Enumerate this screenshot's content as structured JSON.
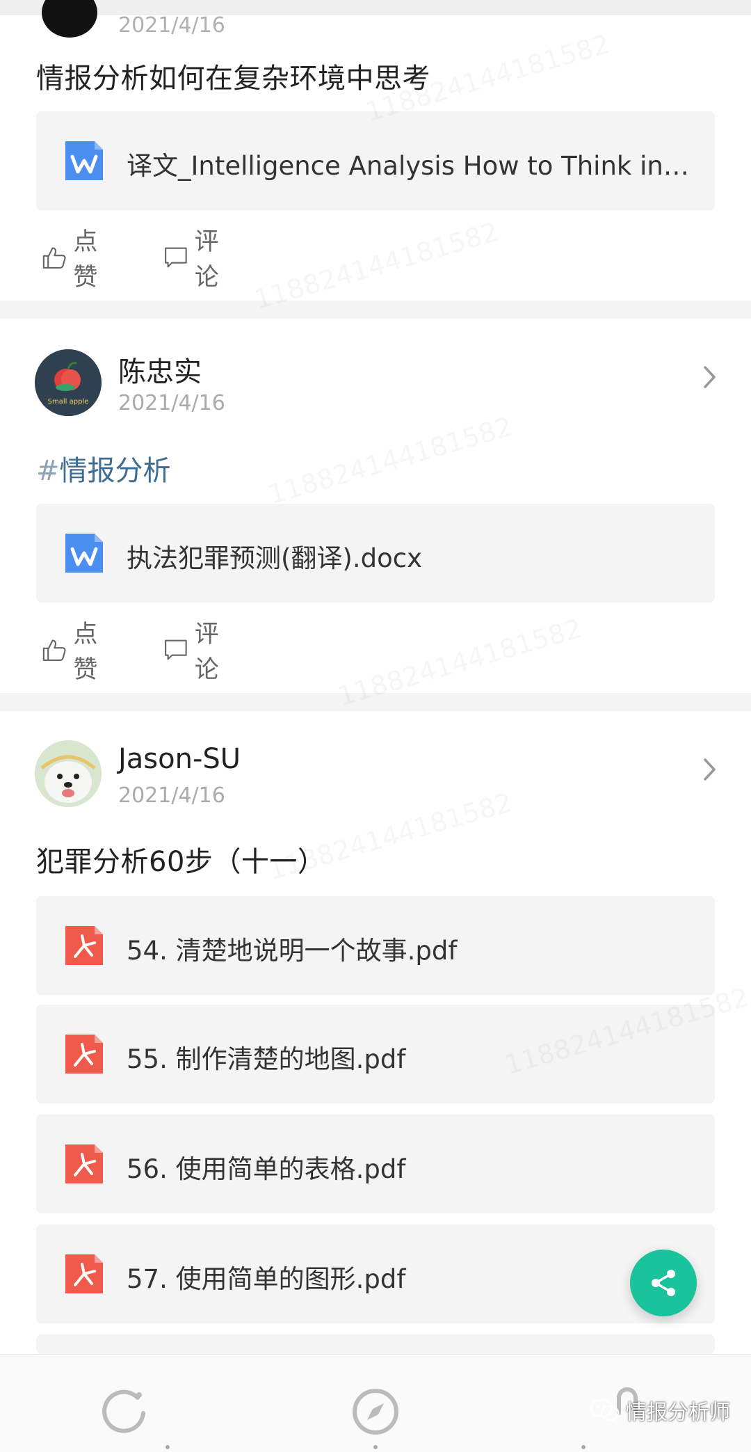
{
  "posts": [
    {
      "date_partial": "2021/4/16",
      "title": "情报分析如何在复杂环境中思考",
      "files": [
        {
          "name": "译文_Intelligence Analysis How to Think in Co…",
          "type": "word"
        }
      ],
      "actions": {
        "like": "点赞",
        "comment": "评论"
      }
    },
    {
      "author": "陈忠实",
      "date": "2021/4/16",
      "tag": "情报分析",
      "tag_hash": "#",
      "files": [
        {
          "name": "执法犯罪预测(翻译).docx",
          "type": "word"
        }
      ],
      "actions": {
        "like": "点赞",
        "comment": "评论"
      }
    },
    {
      "author": "Jason-SU",
      "date": "2021/4/16",
      "title": "犯罪分析60步（十一）",
      "files": [
        {
          "name": "54. 清楚地说明一个故事.pdf",
          "type": "pdf"
        },
        {
          "name": "55. 制作清楚的地图.pdf",
          "type": "pdf"
        },
        {
          "name": "56. 使用简单的表格.pdf",
          "type": "pdf"
        },
        {
          "name": "57. 使用简单的图形.pdf",
          "type": "pdf"
        }
      ]
    }
  ],
  "watermark_text": "118824144181582",
  "watermark_label": "情报分析师",
  "icons": {
    "word": "word-file-icon",
    "pdf": "pdf-file-icon",
    "like": "thumbs-up-icon",
    "comment": "comment-icon",
    "share": "share-icon",
    "nav": [
      "refresh-icon",
      "compass-icon",
      "profile-icon"
    ]
  },
  "colors": {
    "accent": "#19c39b",
    "tag": "#3e6d94",
    "word": "#4a8ef0",
    "pdf": "#f05a4a"
  }
}
